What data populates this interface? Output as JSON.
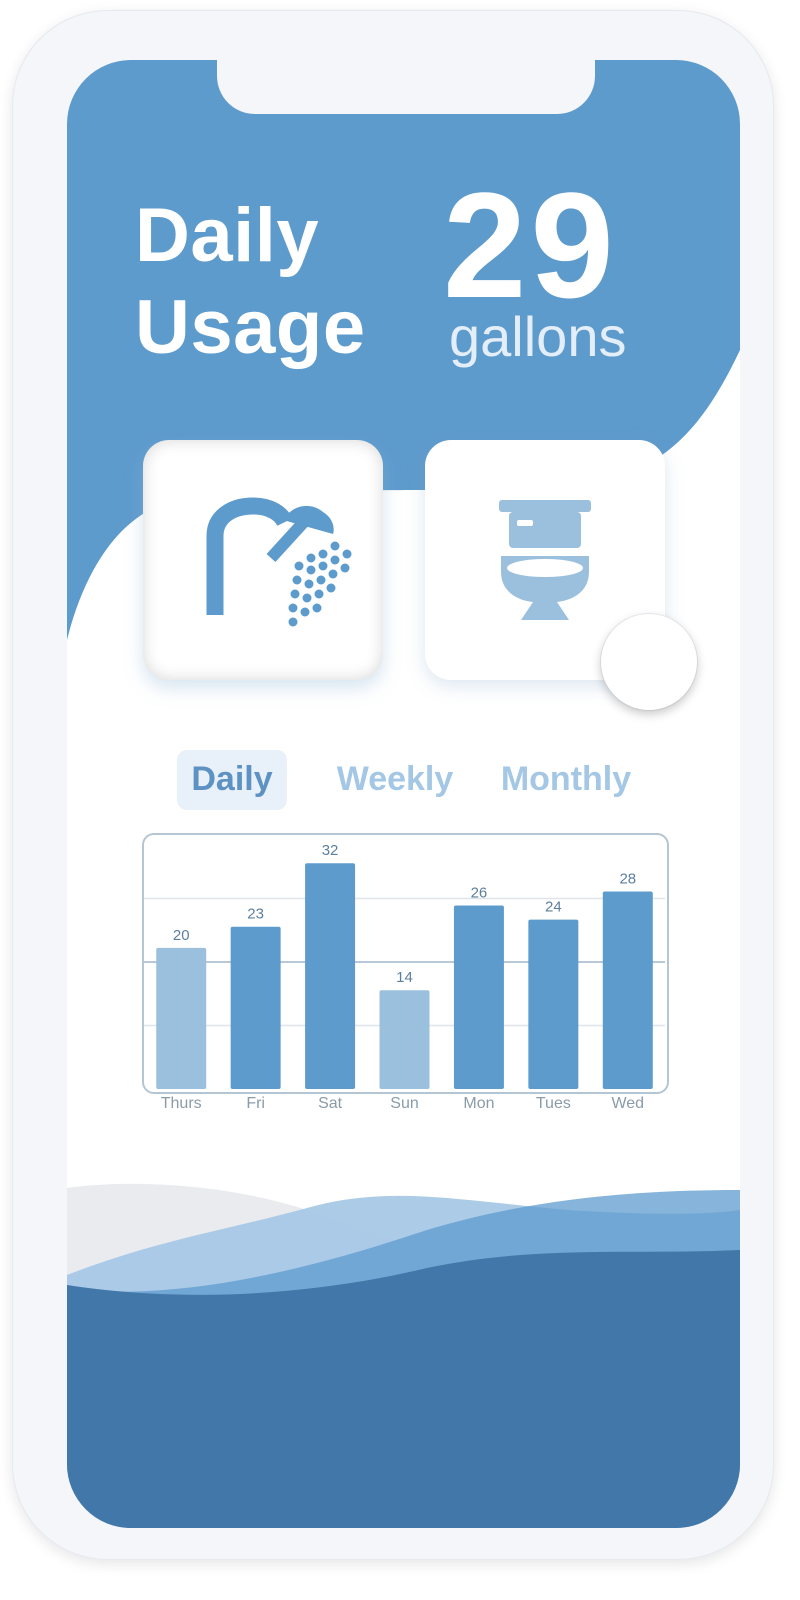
{
  "header": {
    "title_line1": "Daily",
    "title_line2": "Usage",
    "usage_value": "29",
    "usage_unit": "gallons"
  },
  "fixtures": [
    {
      "name": "shower",
      "icon": "shower-icon",
      "selected": true
    },
    {
      "name": "toilet",
      "icon": "toilet-icon",
      "selected": false
    }
  ],
  "tabs": [
    {
      "label": "Daily",
      "active": true
    },
    {
      "label": "Weekly",
      "active": false
    },
    {
      "label": "Monthly",
      "active": false
    }
  ],
  "colors": {
    "primary": "#5e9bcd",
    "accent_light": "#9bc0dd",
    "deep_water": "#4277a9",
    "grid": "#dfe5ea"
  },
  "chart_data": {
    "type": "bar",
    "categories": [
      "Thurs",
      "Fri",
      "Sat",
      "Sun",
      "Mon",
      "Tues",
      "Wed"
    ],
    "values": [
      20,
      23,
      32,
      14,
      26,
      24,
      28
    ],
    "highlight": [
      true,
      false,
      false,
      true,
      false,
      false,
      false
    ],
    "ylim": [
      0,
      36
    ],
    "grid": true
  }
}
